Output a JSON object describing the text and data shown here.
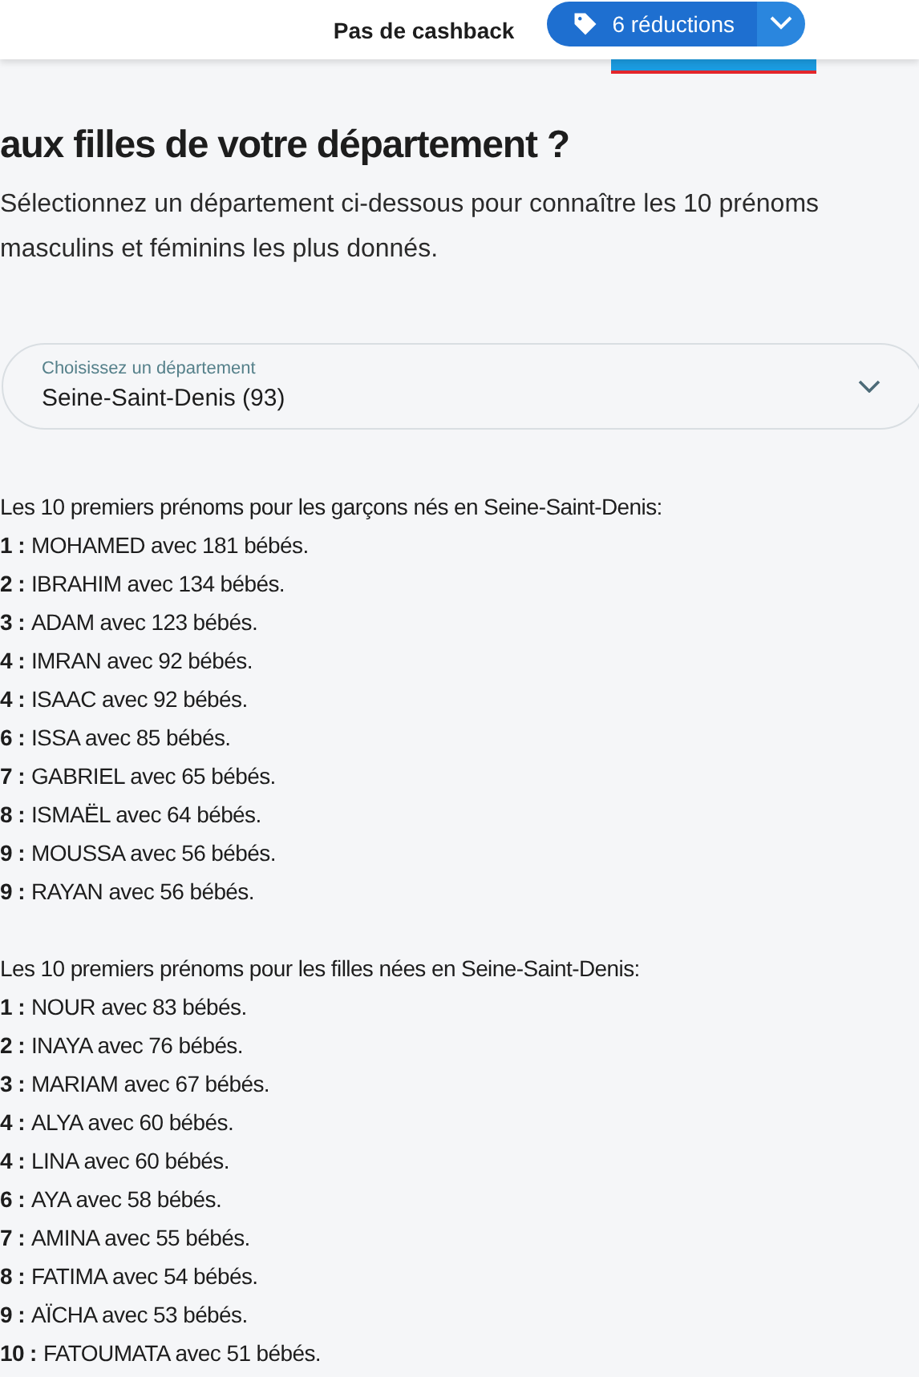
{
  "toolbar": {
    "cashback": "Pas de cashback",
    "offers_button": "6 réductions"
  },
  "title": "aux filles de votre département ?",
  "intro": "Sélectionnez un département ci-dessous pour connaître les 10 prénoms masculins et féminins les plus donnés.",
  "select": {
    "label": "Choisissez un département",
    "value": "Seine-Saint-Denis (93)"
  },
  "lists": [
    {
      "heading": "Les 10 premiers prénoms pour les garçons nés en Seine-Saint-Denis:",
      "items": [
        {
          "rank": "1 :",
          "text": "MOHAMED avec 181 bébés."
        },
        {
          "rank": "2 :",
          "text": "IBRAHIM avec 134 bébés."
        },
        {
          "rank": "3 :",
          "text": "ADAM avec 123 bébés."
        },
        {
          "rank": "4 :",
          "text": "IMRAN avec 92 bébés."
        },
        {
          "rank": "4 :",
          "text": "ISAAC avec 92 bébés."
        },
        {
          "rank": "6 :",
          "text": "ISSA avec 85 bébés."
        },
        {
          "rank": "7 :",
          "text": "GABRIEL avec 65 bébés."
        },
        {
          "rank": "8 :",
          "text": "ISMAËL avec 64 bébés."
        },
        {
          "rank": "9 :",
          "text": "MOUSSA avec 56 bébés."
        },
        {
          "rank": "9 :",
          "text": "RAYAN avec 56 bébés."
        }
      ]
    },
    {
      "heading": "Les 10 premiers prénoms pour les filles nées en Seine-Saint-Denis:",
      "items": [
        {
          "rank": "1 :",
          "text": "NOUR avec 83 bébés."
        },
        {
          "rank": "2 :",
          "text": "INAYA avec 76 bébés."
        },
        {
          "rank": "3 :",
          "text": "MARIAM avec 67 bébés."
        },
        {
          "rank": "4 :",
          "text": "ALYA avec 60 bébés."
        },
        {
          "rank": "4 :",
          "text": "LINA avec 60 bébés."
        },
        {
          "rank": "6 :",
          "text": "AYA avec 58 bébés."
        },
        {
          "rank": "7 :",
          "text": "AMINA avec 55 bébés."
        },
        {
          "rank": "8 :",
          "text": "FATIMA avec 54 bébés."
        },
        {
          "rank": "9 :",
          "text": "AÏCHA avec 53 bébés."
        },
        {
          "rank": "10 :",
          "text": "FATOUMATA avec 51 bébés."
        }
      ]
    }
  ]
}
